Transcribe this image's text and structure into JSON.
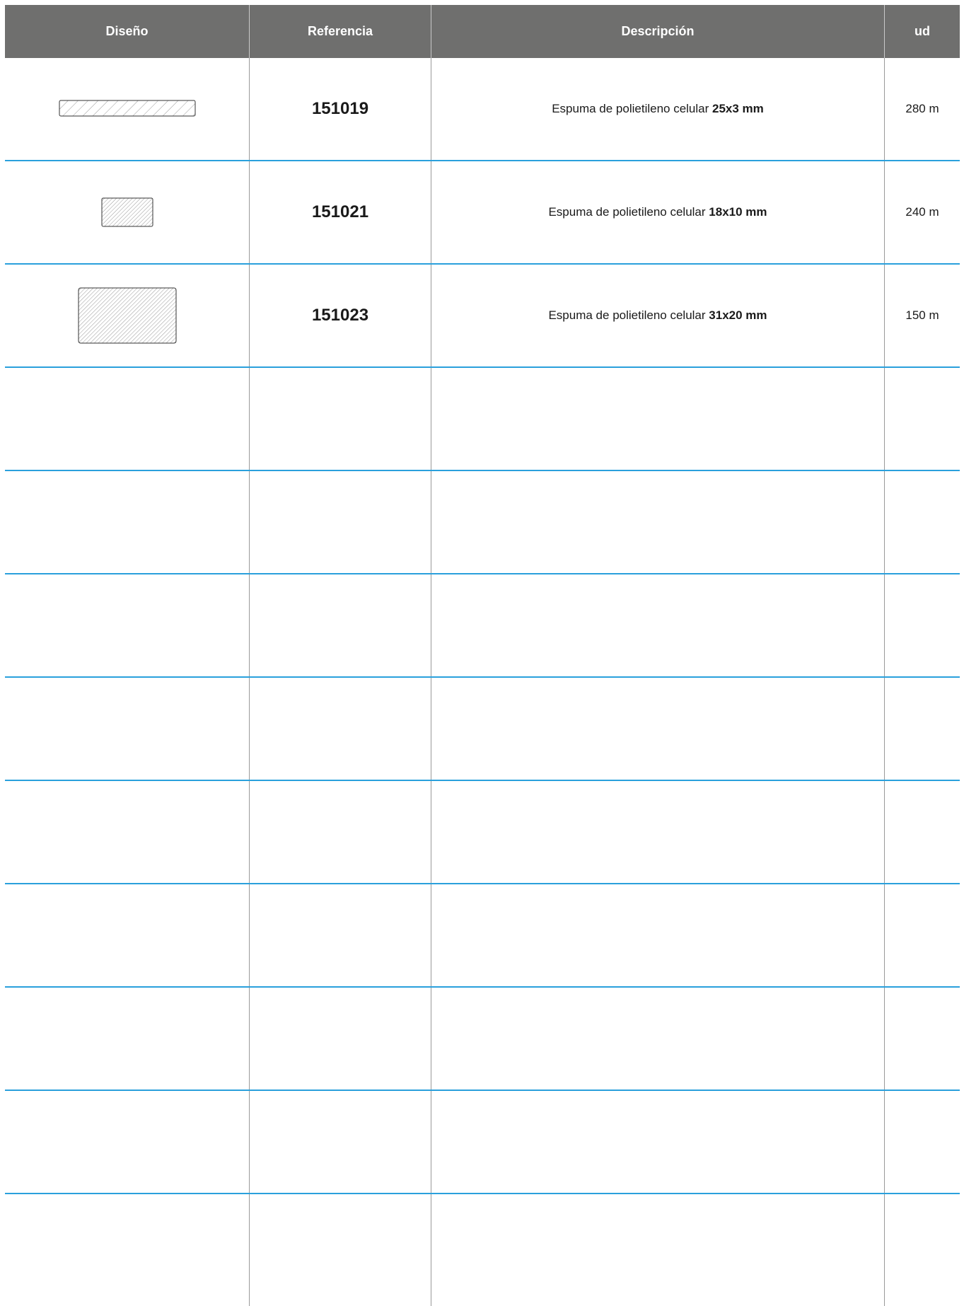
{
  "header": {
    "design": "Diseño",
    "reference": "Referencia",
    "description": "Descripción",
    "unit": "ud"
  },
  "rows": [
    {
      "reference": "151019",
      "description_prefix": "Espuma de polietileno celular ",
      "description_size": "25x3 mm",
      "unit": "280 m",
      "design_icon": "thin-strip-profile-icon"
    },
    {
      "reference": "151021",
      "description_prefix": "Espuma de polietileno celular ",
      "description_size": "18x10 mm",
      "unit": "240 m",
      "design_icon": "small-rectangle-profile-icon"
    },
    {
      "reference": "151023",
      "description_prefix": "Espuma de polietileno celular ",
      "description_size": "31x20 mm",
      "unit": "150 m",
      "design_icon": "large-rectangle-profile-icon"
    }
  ],
  "colors": {
    "header_bg": "#6f6f6e",
    "row_separator": "#2aa0dc",
    "column_separator": "#9a9a9a"
  }
}
